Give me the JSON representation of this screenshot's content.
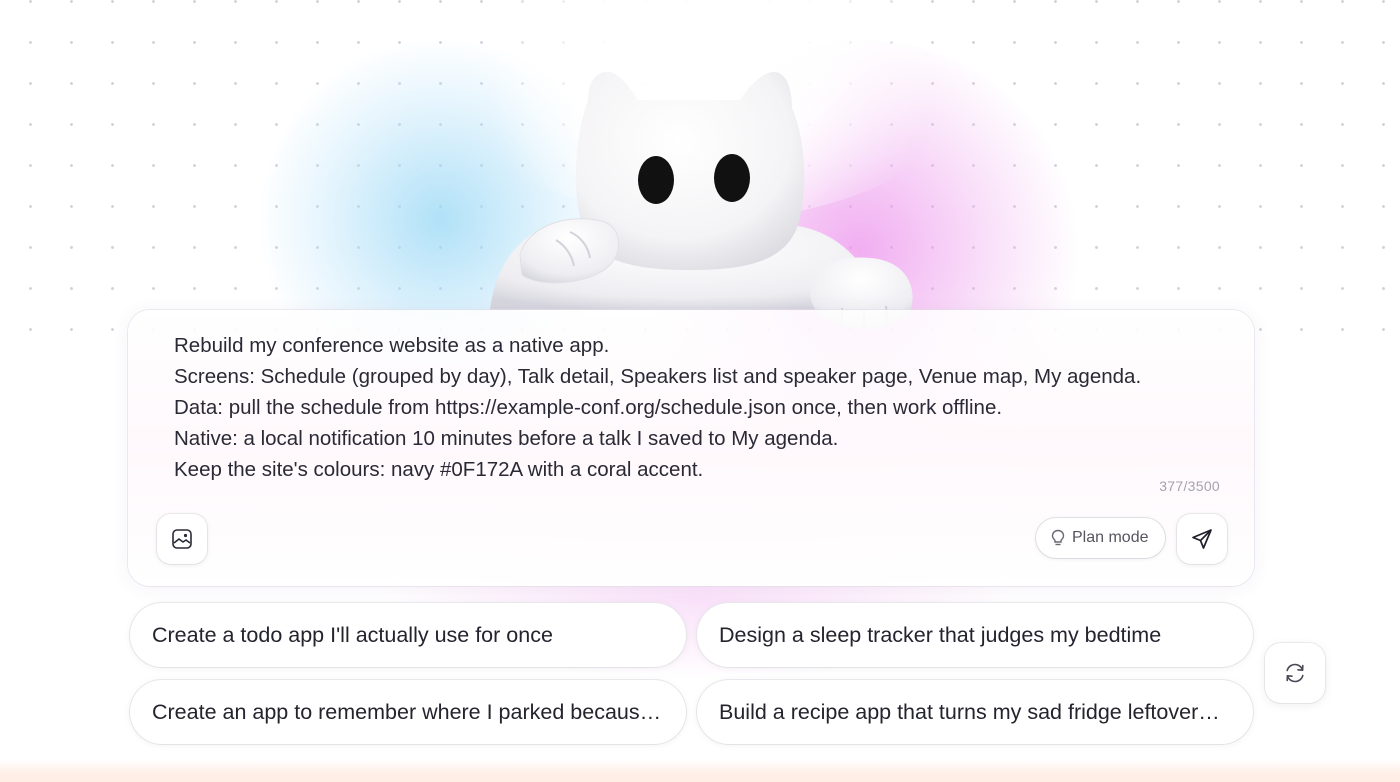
{
  "prompt": {
    "lines": [
      "Rebuild my conference website as a native app.",
      "Screens: Schedule (grouped by day), Talk detail, Speakers list and speaker page, Venue map, My agenda.",
      "Data: pull the schedule from https://example-conf.org/schedule.json once, then work offline.",
      "Native: a local notification 10 minutes before a talk I saved to My agenda.",
      "Keep the site's colours: navy #0F172A with a coral accent."
    ],
    "char_count": "377/3500"
  },
  "toolbar": {
    "attach_icon": "image-upload-icon",
    "plan_icon": "lightbulb-icon",
    "plan_label": "Plan mode",
    "send_icon": "send-icon"
  },
  "suggestions": [
    "Create a todo app I'll actually use for once",
    "Design a sleep tracker that judges my bedtime",
    "Create an app to remember where I parked because I ne...",
    "Build a recipe app that turns my sad fridge leftovers into..."
  ],
  "refresh_icon": "refresh-icon",
  "mascot": "white-cat-mascot",
  "colors": {
    "text": "#2a2a36",
    "muted": "#a3a3ad",
    "glow_cyan": "#9fd8f4",
    "glow_pink": "#ec8eec"
  }
}
